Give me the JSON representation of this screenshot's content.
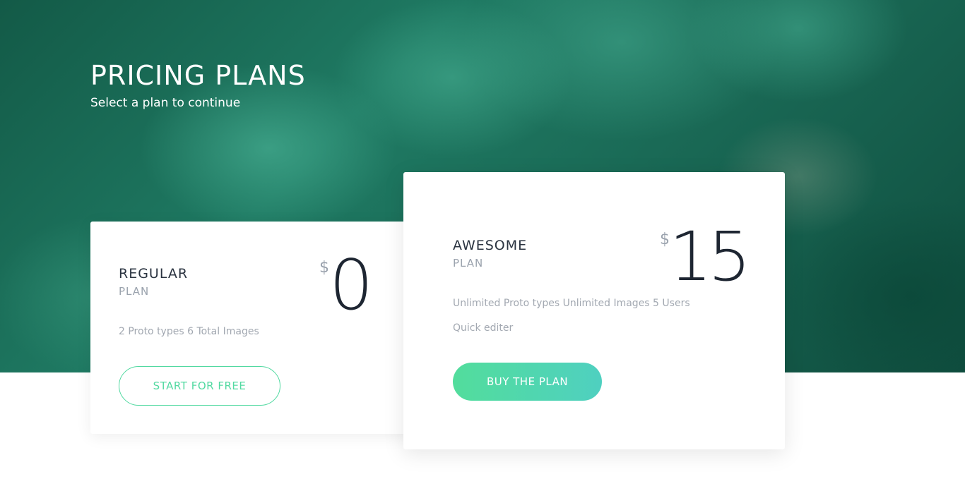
{
  "hero": {
    "title": "PRICING PLANS",
    "subtitle": "Select a plan to continue"
  },
  "plans": [
    {
      "name": "REGULAR",
      "sub": "PLAN",
      "currency": "$",
      "price": "0",
      "features": [
        "2 Proto types 6 Total Images"
      ],
      "button_label": "START FOR FREE"
    },
    {
      "name": "AWESOME",
      "sub": "PLAN",
      "currency": "$",
      "price": "15",
      "features": [
        "Unlimited Proto types Unlimited Images 5 Users",
        "Quick editer"
      ],
      "button_label": "BUY THE PLAN"
    }
  ],
  "colors": {
    "accent_green": "#52d9a1",
    "accent_teal": "#4fd0c0",
    "hero_green": "#1f7a63",
    "text_dark": "#2b3441",
    "text_muted": "#9aa2ad"
  }
}
